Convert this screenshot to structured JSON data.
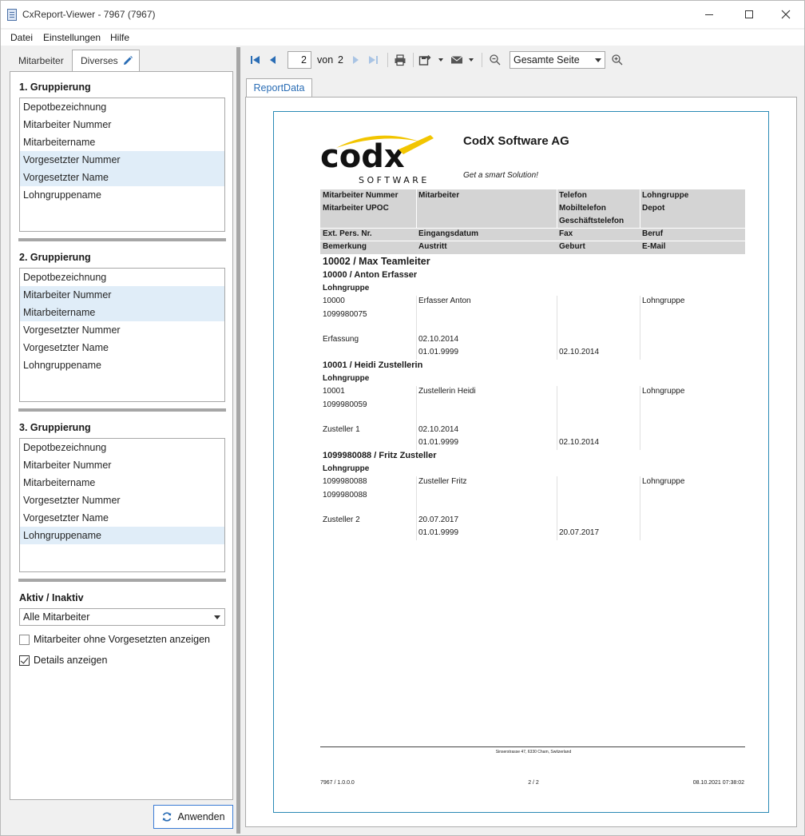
{
  "window": {
    "title": "CxReport-Viewer - 7967 (7967)"
  },
  "menu": {
    "file": "Datei",
    "settings": "Einstellungen",
    "help": "Hilfe"
  },
  "left_panel": {
    "tabs": [
      "Mitarbeiter",
      "Diverses"
    ],
    "group1": {
      "label": "1. Gruppierung",
      "items": [
        "Depotbezeichnung",
        "Mitarbeiter Nummer",
        "Mitarbeitername",
        "Vorgesetzter Nummer",
        "Vorgesetzter Name",
        "Lohngruppename"
      ]
    },
    "group2": {
      "label": "2. Gruppierung",
      "items": [
        "Depotbezeichnung",
        "Mitarbeiter Nummer",
        "Mitarbeitername",
        "Vorgesetzter Nummer",
        "Vorgesetzter Name",
        "Lohngruppename"
      ]
    },
    "group3": {
      "label": "3. Gruppierung",
      "items": [
        "Depotbezeichnung",
        "Mitarbeiter Nummer",
        "Mitarbeitername",
        "Vorgesetzter Nummer",
        "Vorgesetzter Name",
        "Lohngruppename"
      ]
    },
    "aktiv_label": "Aktiv / Inaktiv",
    "aktiv_value": "Alle Mitarbeiter",
    "checkbox_ohne_vorgesetzten": "Mitarbeiter ohne Vorgesetzten anzeigen",
    "checkbox_details": "Details anzeigen",
    "apply_button": "Anwenden"
  },
  "toolbar": {
    "current_page": "2",
    "of_label": "von",
    "total_pages": "2",
    "zoom": "Gesamte Seite"
  },
  "report": {
    "tab": "ReportData",
    "company": "CodX Software AG",
    "slogan": "Get a smart Solution!",
    "logo_text": "codx",
    "logo_sub": "SOFTWARE",
    "header": {
      "c1": [
        "Mitarbeiter Nummer",
        "Mitarbeiter UPOC",
        "",
        "Ext. Pers. Nr.",
        "Bemerkung"
      ],
      "c2": [
        "Mitarbeiter",
        "",
        "",
        "Eingangsdatum",
        "Austritt"
      ],
      "c3": [
        "Telefon",
        "Mobiltelefon",
        "Geschäftstelefon",
        "Fax",
        "Geburt"
      ],
      "c4": [
        "Lohngruppe",
        "Depot",
        "",
        "Beruf",
        "E-Mail"
      ]
    },
    "group_title": "10002 / Max Teamleiter",
    "employees": [
      {
        "title": "10000 / Anton Erfasser",
        "sub": "Lohngruppe",
        "number": "10000",
        "name": "Erfasser Anton",
        "lohngruppe": "Lohngruppe",
        "upoc": "1099980075",
        "remark": "Erfassung",
        "entry": "02.10.2014",
        "exit": "01.01.9999",
        "birth": "02.10.2014"
      },
      {
        "title": "10001 / Heidi Zustellerin",
        "sub": "Lohngruppe",
        "number": "10001",
        "name": "Zustellerin Heidi",
        "lohngruppe": "Lohngruppe",
        "upoc": "1099980059",
        "remark": "Zusteller 1",
        "entry": "02.10.2014",
        "exit": "01.01.9999",
        "birth": "02.10.2014"
      },
      {
        "title": "1099980088 / Fritz Zusteller",
        "sub": "Lohngruppe",
        "number": "1099980088",
        "name": "Zusteller  Fritz",
        "lohngruppe": "Lohngruppe",
        "upoc": "1099980088",
        "remark": "Zusteller 2",
        "entry": "20.07.2017",
        "exit": "01.01.9999",
        "birth": "20.07.2017"
      }
    ],
    "footer_address": "Sinserstrasse 47, 6330 Cham, Switzerland",
    "footer_version": "7967 / 1.0.0.0",
    "footer_pages": "2 / 2",
    "footer_date": "08.10.2021 07:38:02"
  },
  "colors": {
    "accent": "#2a6db5",
    "selection": "#e0edf8",
    "header_bg": "#d4d4d4",
    "logo_yellow": "#f2c500"
  }
}
